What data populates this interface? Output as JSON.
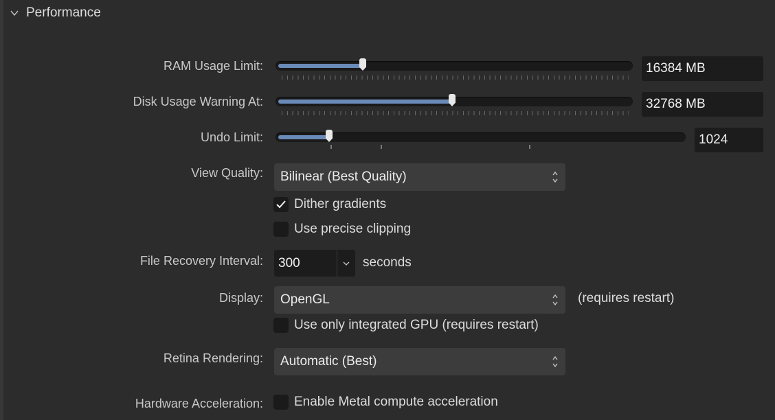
{
  "section": {
    "title": "Performance",
    "icon": "chevron-down-icon"
  },
  "ram": {
    "label": "RAM Usage Limit:",
    "value": "16384 MB",
    "fill_fraction": 0.245
  },
  "disk": {
    "label": "Disk Usage Warning At:",
    "value": "32768 MB",
    "fill_fraction": 0.495
  },
  "undo": {
    "label": "Undo Limit:",
    "value": "1024",
    "fill_fraction": 0.13
  },
  "view_quality": {
    "label": "View Quality:",
    "selected": "Bilinear (Best Quality)"
  },
  "dither": {
    "label": "Dither gradients",
    "checked": true
  },
  "precise_clipping": {
    "label": "Use precise clipping",
    "checked": false
  },
  "file_recovery": {
    "label": "File Recovery Interval:",
    "value": "300",
    "unit": "seconds"
  },
  "display": {
    "label": "Display:",
    "selected": "OpenGL",
    "note": "(requires restart)"
  },
  "integrated_gpu": {
    "label": "Use only integrated GPU (requires restart)",
    "checked": false
  },
  "retina": {
    "label": "Retina Rendering:",
    "selected": "Automatic (Best)"
  },
  "hardware_accel": {
    "label": "Hardware Acceleration:",
    "option_label": "Enable Metal compute acceleration",
    "checked": false
  },
  "colors": {
    "accent_fill": "#6a8ab8",
    "background": "#2c2c2c",
    "field": "#1c1c1c"
  }
}
